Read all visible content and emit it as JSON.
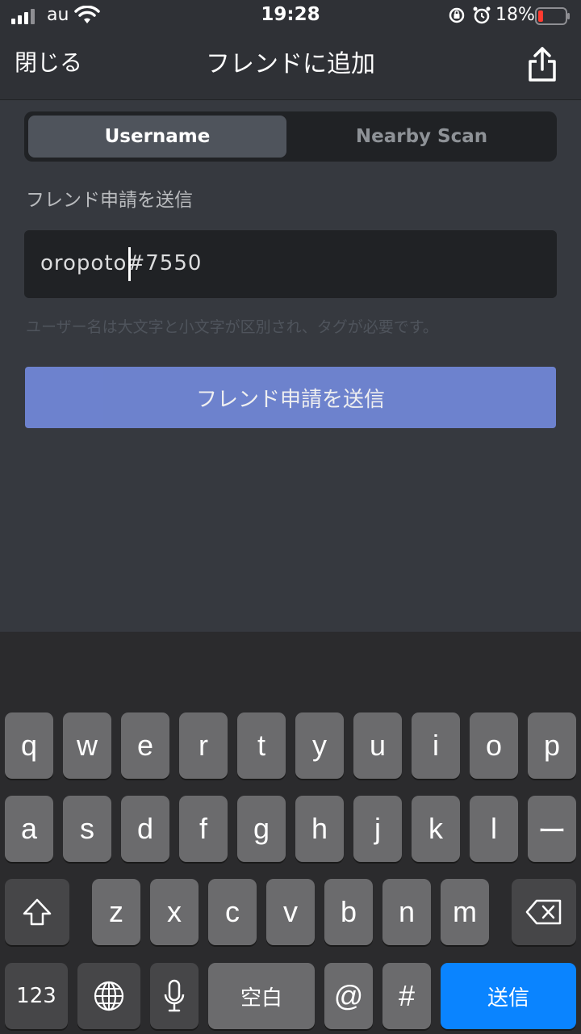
{
  "status_bar": {
    "carrier": "au",
    "time": "19:28",
    "battery_percent": "18%"
  },
  "nav": {
    "close_label": "閉じる",
    "title": "フレンドに追加"
  },
  "tabs": [
    {
      "label": "Username",
      "active": true
    },
    {
      "label": "Nearby Scan",
      "active": false
    }
  ],
  "form": {
    "section_label": "フレンド申請を送信",
    "input_value": "oropoto#7550",
    "hint": "ユーザー名は大文字と小文字が区別され、タグが必要です。",
    "submit_label": "フレンド申請を送信"
  },
  "keyboard": {
    "row1": [
      "q",
      "w",
      "e",
      "r",
      "t",
      "y",
      "u",
      "i",
      "o",
      "p"
    ],
    "row2": [
      "a",
      "s",
      "d",
      "f",
      "g",
      "h",
      "j",
      "k",
      "l",
      "ー"
    ],
    "row3": [
      "z",
      "x",
      "c",
      "v",
      "b",
      "n",
      "m"
    ],
    "numbers_label": "123",
    "space_label": "空白",
    "at_label": "@",
    "hash_label": "#",
    "return_label": "送信"
  },
  "colors": {
    "background": "#36393f",
    "header": "#2f3136",
    "input": "#202225",
    "accent": "#7289da",
    "return_key": "#0a84ff",
    "battery_low": "#ff3b30"
  }
}
